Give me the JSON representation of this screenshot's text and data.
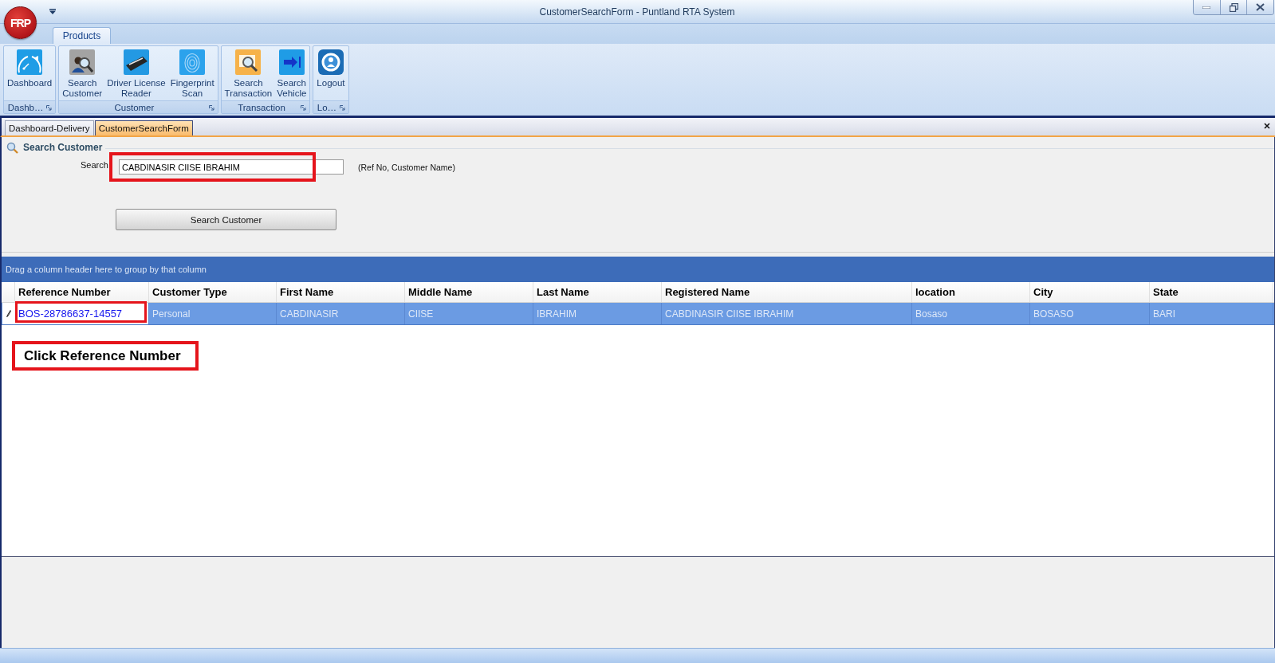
{
  "window": {
    "title": "CustomerSearchForm - Puntland RTA System",
    "logo": "FRP"
  },
  "ribbon": {
    "tabs": [
      {
        "label": "Products",
        "selected": true
      }
    ],
    "groups": [
      {
        "label": "Dashb…",
        "items": [
          {
            "kind": "dashboard",
            "lines": [
              "Dashboard"
            ]
          }
        ]
      },
      {
        "label": "Customer",
        "items": [
          {
            "kind": "search-customer",
            "lines": [
              "Search",
              "Customer"
            ]
          },
          {
            "kind": "license-reader",
            "lines": [
              "Driver License",
              "Reader"
            ]
          },
          {
            "kind": "fingerprint",
            "lines": [
              "Fingerprint",
              "Scan"
            ]
          }
        ]
      },
      {
        "label": "Transaction",
        "items": [
          {
            "kind": "search-transaction",
            "lines": [
              "Search",
              "Transaction"
            ]
          },
          {
            "kind": "search-vehicle",
            "lines": [
              "Search",
              "Vehicle"
            ]
          }
        ]
      },
      {
        "label": "Lo…",
        "items": [
          {
            "kind": "logout",
            "lines": [
              "Logout"
            ]
          }
        ]
      }
    ]
  },
  "document_tabs": [
    {
      "label": "Dashboard-Delivery",
      "selected": false
    },
    {
      "label": "CustomerSearchForm",
      "selected": true
    }
  ],
  "search_panel": {
    "title": "Search Customer",
    "field_label": "Search",
    "field_value": "CABDINASIR CIISE IBRAHIM",
    "field_highlighted": true,
    "hint": "(Ref No, Customer Name)",
    "button": "Search Customer"
  },
  "grid": {
    "group_panel": "Drag a column header here to group by that column",
    "columns": [
      "Reference Number",
      "Customer Type",
      "First Name",
      "Middle Name",
      "Last Name",
      "Registered Name",
      "location",
      "City",
      "State"
    ],
    "rows": [
      {
        "selected": true,
        "editing": true,
        "cells": [
          {
            "text": "BOS-28786637-14557",
            "kind": "link",
            "highlighted": true
          },
          {
            "text": "Personal",
            "kind": "text",
            "highlighted": false
          },
          {
            "text": "CABDINASIR",
            "kind": "text",
            "highlighted": false
          },
          {
            "text": "CIISE",
            "kind": "text",
            "highlighted": false
          },
          {
            "text": "IBRAHIM",
            "kind": "text",
            "highlighted": false
          },
          {
            "text": "CABDINASIR CIISE IBRAHIM",
            "kind": "text",
            "highlighted": false
          },
          {
            "text": "Bosaso",
            "kind": "text",
            "highlighted": false
          },
          {
            "text": "BOSASO",
            "kind": "text",
            "highlighted": false
          },
          {
            "text": "BARI",
            "kind": "text",
            "highlighted": false
          }
        ]
      }
    ]
  },
  "callout": {
    "text": "Click Reference Number"
  }
}
